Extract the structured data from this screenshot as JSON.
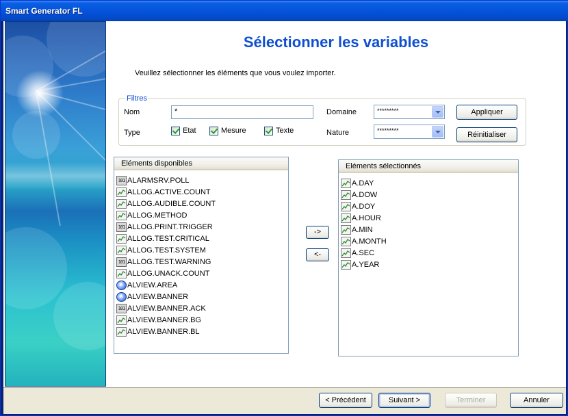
{
  "window": {
    "title": "Smart Generator FL"
  },
  "page": {
    "heading": "Sélectionner les variables",
    "instructions": "Veuillez sélectionner les éléments que vous voulez importer."
  },
  "filters": {
    "group_label": "Filtres",
    "name_label": "Nom",
    "name_value": "*",
    "type_label": "Type",
    "types": [
      {
        "label": "Etat",
        "checked": true
      },
      {
        "label": "Mesure",
        "checked": true
      },
      {
        "label": "Texte",
        "checked": true
      }
    ],
    "domain_label": "Domaine",
    "domain_value": "*********",
    "nature_label": "Nature",
    "nature_value": "*********",
    "apply_label": "Appliquer",
    "reset_label": "Réinitialiser"
  },
  "available": {
    "header": "Eléments disponibles",
    "items": [
      {
        "label": "ALARMSRV.POLL",
        "icon": "binary-variable-icon"
      },
      {
        "label": "ALLOG.ACTIVE.COUNT",
        "icon": "analog-variable-icon"
      },
      {
        "label": "ALLOG.AUDIBLE.COUNT",
        "icon": "analog-variable-icon"
      },
      {
        "label": "ALLOG.METHOD",
        "icon": "analog-variable-icon"
      },
      {
        "label": "ALLOG.PRINT.TRIGGER",
        "icon": "binary-variable-icon"
      },
      {
        "label": "ALLOG.TEST.CRITICAL",
        "icon": "analog-variable-icon"
      },
      {
        "label": "ALLOG.TEST.SYSTEM",
        "icon": "analog-variable-icon"
      },
      {
        "label": "ALLOG.TEST.WARNING",
        "icon": "binary-variable-icon"
      },
      {
        "label": "ALLOG.UNACK.COUNT",
        "icon": "analog-variable-icon"
      },
      {
        "label": "ALVIEW.AREA",
        "icon": "alarm-view-icon"
      },
      {
        "label": "ALVIEW.BANNER",
        "icon": "alarm-view-icon"
      },
      {
        "label": "ALVIEW.BANNER.ACK",
        "icon": "binary-variable-icon"
      },
      {
        "label": "ALVIEW.BANNER.BG",
        "icon": "analog-variable-icon"
      },
      {
        "label": "ALVIEW.BANNER.BL",
        "icon": "analog-variable-icon"
      }
    ]
  },
  "transfer": {
    "add_label": "->",
    "remove_label": "<-"
  },
  "selected": {
    "header": "Eléments sélectionnés",
    "items": [
      {
        "label": "A.DAY",
        "icon": "analog-variable-icon"
      },
      {
        "label": "A.DOW",
        "icon": "analog-variable-icon"
      },
      {
        "label": "A.DOY",
        "icon": "analog-variable-icon"
      },
      {
        "label": "A.HOUR",
        "icon": "analog-variable-icon"
      },
      {
        "label": "A.MIN",
        "icon": "analog-variable-icon"
      },
      {
        "label": "A.MONTH",
        "icon": "analog-variable-icon"
      },
      {
        "label": "A.SEC",
        "icon": "analog-variable-icon"
      },
      {
        "label": "A.YEAR",
        "icon": "analog-variable-icon"
      }
    ]
  },
  "footer": {
    "back_label": "< Précédent",
    "next_label": "Suivant >",
    "finish_label": "Terminer",
    "cancel_label": "Annuler"
  },
  "colors": {
    "titlebar": "#0553dc",
    "heading": "#1050d0",
    "group_title": "#0046d5"
  }
}
